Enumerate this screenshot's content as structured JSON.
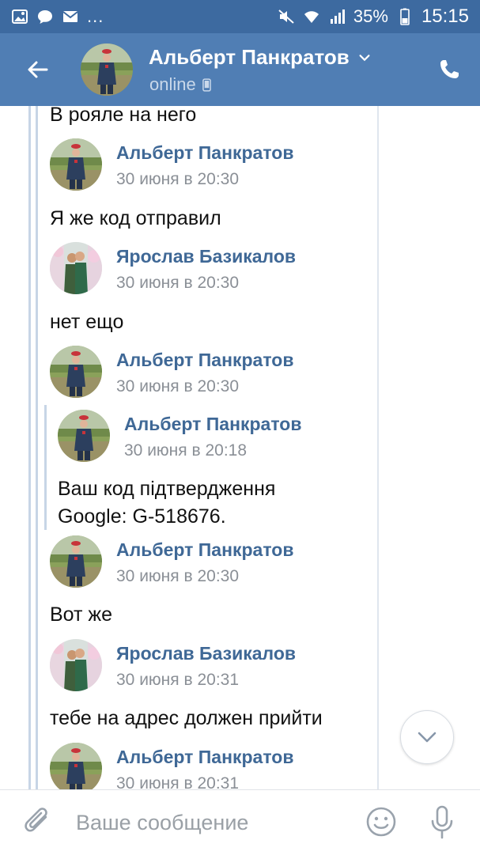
{
  "status_bar": {
    "battery": "35%",
    "time": "15:15",
    "dots": "..."
  },
  "header": {
    "name": "Альберт Панкратов",
    "status": "online"
  },
  "messages": [
    {
      "type": "text",
      "text": "В рояле на него"
    },
    {
      "type": "head",
      "author": "Альберт Панкратов",
      "time": "30 июня в 20:30"
    },
    {
      "type": "text",
      "text": "Я же код отправил"
    },
    {
      "type": "head",
      "author": "Ярослав Базикалов",
      "time": "30 июня в 20:30"
    },
    {
      "type": "text",
      "text": "нет ещо"
    },
    {
      "type": "head",
      "author": "Альберт Панкратов",
      "time": "30 июня в 20:30"
    },
    {
      "type": "head",
      "author": "Альберт Панкратов",
      "time": "30 июня в 20:18"
    },
    {
      "type": "text",
      "text": "Ваш код підтвердження"
    },
    {
      "type": "text",
      "text": "Google: G-518676."
    },
    {
      "type": "head",
      "author": "Альберт Панкратов",
      "time": "30 июня в 20:30"
    },
    {
      "type": "text",
      "text": "Вот же"
    },
    {
      "type": "head",
      "author": "Ярослав Базикалов",
      "time": "30 июня в 20:31"
    },
    {
      "type": "text",
      "text": "тебе на адрес должен прийти"
    },
    {
      "type": "head",
      "author": "Альберт Панкратов",
      "time": "30 июня в 20:31"
    }
  ],
  "composer": {
    "placeholder": "Ваше сообщение"
  },
  "icons": {
    "back": "arrow-left-icon",
    "call": "phone-icon",
    "attach": "paperclip-icon",
    "emoji": "smiley-icon",
    "mic": "microphone-icon",
    "scroll": "chevron-down-icon"
  },
  "colors": {
    "status_bar": "#3d6aa0",
    "header": "#507eb4",
    "author": "#3f6896",
    "time": "#8a8f96"
  }
}
